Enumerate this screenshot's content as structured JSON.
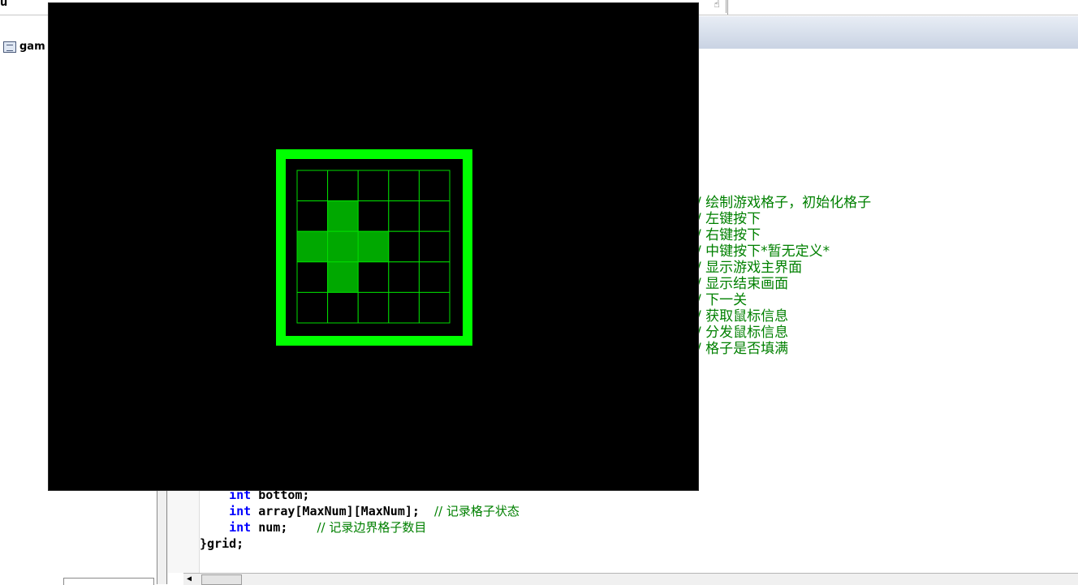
{
  "window_title_fragment": "u",
  "project_tree": {
    "item_label": "gam"
  },
  "toolbar": {
    "fragment_icon": "hand-icon"
  },
  "code": {
    "lines": [
      {
        "indent": "    ",
        "type": "int",
        "rest": "bottom;",
        "comment": ""
      },
      {
        "indent": "    ",
        "type": "int",
        "rest": "array[MaxNum][MaxNum];  ",
        "comment": "// 记录格子状态"
      },
      {
        "indent": "    ",
        "type": "int",
        "rest": "num;    ",
        "comment": "// 记录边界格子数目"
      }
    ],
    "closing": "}grid;"
  },
  "comments_right": [
    "/ 绘制游戏格子，初始化格子",
    "/ 左键按下",
    "/ 右键按下",
    "/ 中键按下*暂无定义*",
    "/ 显示游戏主界面",
    "/ 显示结束画面",
    "/ 下一关",
    "/ 获取鼠标信息",
    "/ 分发鼠标信息",
    "/ 格子是否填满"
  ],
  "game": {
    "background": "#000000",
    "border_color": "#00ff00",
    "grid_line_color": "#00dd00",
    "filled_color": "#00a800",
    "rows": 5,
    "cols": 5,
    "filled_cells": [
      [
        1,
        1
      ],
      [
        2,
        0
      ],
      [
        2,
        1
      ],
      [
        2,
        2
      ],
      [
        3,
        1
      ]
    ]
  },
  "colors": {
    "keyword": "#0000ff",
    "comment": "#008000"
  }
}
